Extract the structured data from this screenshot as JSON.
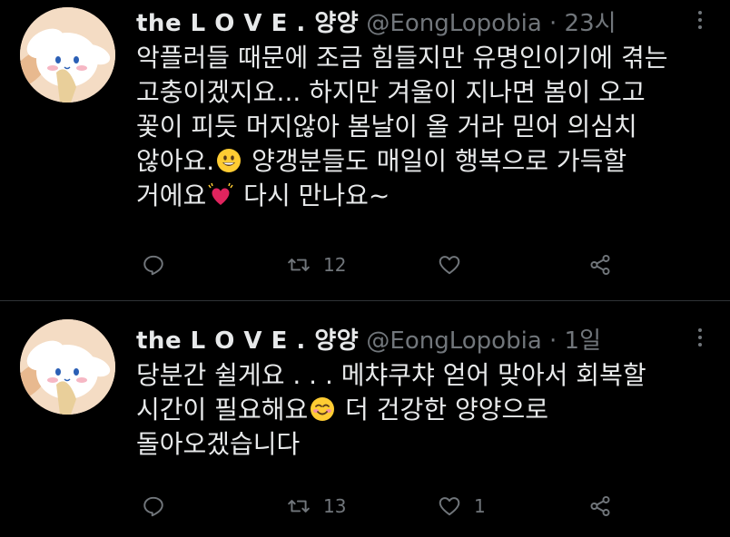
{
  "tweets": [
    {
      "author_name": "the L O V E . 양양",
      "handle": "@EongLopobia",
      "separator": "·",
      "time": "23시",
      "lines": [
        "악플러들 때문에 조금 힘들지만 유명인이기에 겪는",
        "고충이겠지요... 하지만 겨울이 지나면 봄이 오고",
        "꽃이 피듯 머지않아 봄날이 올 거라 믿어 의심치",
        "않아요.",
        " 양갱분들도 매일이 행복으로 가득할",
        "거에요",
        " 다시 만나요~"
      ],
      "emojis": [
        "grinning-face-emoji",
        "beating-heart-emoji"
      ],
      "reply_count": "",
      "retweet_count": "12",
      "like_count": "",
      "share_count": ""
    },
    {
      "author_name": "the L O V E . 양양",
      "handle": "@EongLopobia",
      "separator": "·",
      "time": "1일",
      "lines": [
        "당분간 쉴게요 . . . 메챠쿠챠 얻어 맞아서 회복할",
        "시간이 필요해요",
        " 더 건강한 양양으로",
        "돌아오겠습니다"
      ],
      "emojis": [
        "smiling-face-with-smiling-eyes-emoji"
      ],
      "reply_count": "",
      "retweet_count": "13",
      "like_count": "1",
      "share_count": ""
    }
  ],
  "colors": {
    "background": "#000000",
    "text": "#e7e9ea",
    "muted": "#71767b",
    "divider": "#2f3336"
  },
  "icons": [
    "reply-icon",
    "retweet-icon",
    "like-icon",
    "share-icon",
    "more-icon"
  ]
}
